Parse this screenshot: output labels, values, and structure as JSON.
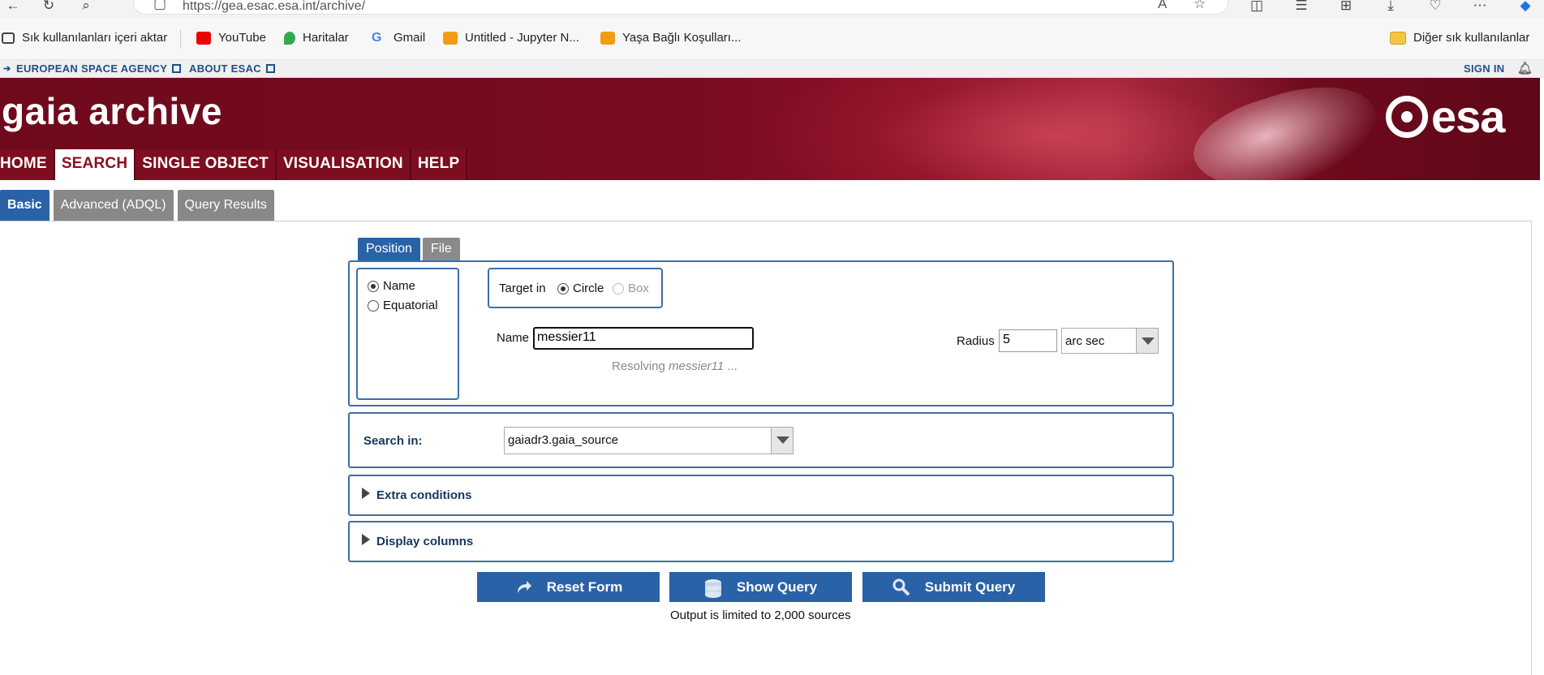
{
  "browser": {
    "url": "https://gea.esac.esa.int/archive/",
    "bookmarks": [
      "Sık kullanılanları içeri aktar",
      "YouTube",
      "Haritalar",
      "Gmail",
      "Untitled - Jupyter N...",
      "Yaşa Bağlı Koşulları..."
    ],
    "other_bookmarks": "Diğer sık kullanılanlar"
  },
  "esa_strip": {
    "agency": "EUROPEAN SPACE AGENCY",
    "about": "ABOUT ESAC",
    "signin": "SIGN IN"
  },
  "banner": {
    "title": "gaia archive",
    "logo_text": "esa"
  },
  "mainnav": [
    "HOME",
    "SEARCH",
    "SINGLE OBJECT",
    "VISUALISATION",
    "HELP"
  ],
  "subtabs": [
    "Basic",
    "Advanced (ADQL)",
    "Query Results"
  ],
  "position_tabs": [
    "Position",
    "File"
  ],
  "position": {
    "coord_options": [
      "Name",
      "Equatorial"
    ],
    "target_in_label": "Target in",
    "shape_options": [
      "Circle",
      "Box"
    ],
    "name_label": "Name",
    "name_value": "messier11",
    "resolving_prefix": "Resolving",
    "resolving_target": "messier11",
    "resolving_suffix": "...",
    "radius_label": "Radius",
    "radius_value": "5",
    "radius_unit": "arc sec"
  },
  "search_in": {
    "label": "Search in:",
    "value": "gaiadr3.gaia_source"
  },
  "extra_conditions": "Extra conditions",
  "display_columns": "Display columns",
  "buttons": {
    "reset": "Reset Form",
    "show": "Show Query",
    "submit": "Submit Query"
  },
  "note": "Output is limited to 2,000 sources",
  "colors": {
    "banner": "#7a0b20",
    "accent_blue": "#2a62a8",
    "panel_border": "#3c6fa6"
  }
}
